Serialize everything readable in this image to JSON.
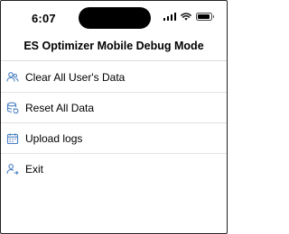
{
  "status_bar": {
    "time": "6:07"
  },
  "header": {
    "title": "ES Optimizer Mobile Debug Mode"
  },
  "menu": {
    "items": [
      {
        "label": "Clear All User's Data",
        "icon": "users-icon"
      },
      {
        "label": "Reset All Data",
        "icon": "database-reset-icon"
      },
      {
        "label": "Upload logs",
        "icon": "calendar-icon"
      },
      {
        "label": "Exit",
        "icon": "user-exit-icon"
      }
    ]
  },
  "colors": {
    "icon_blue": "#4a7fc1",
    "divider": "#e3e3e3",
    "text": "#000000"
  }
}
